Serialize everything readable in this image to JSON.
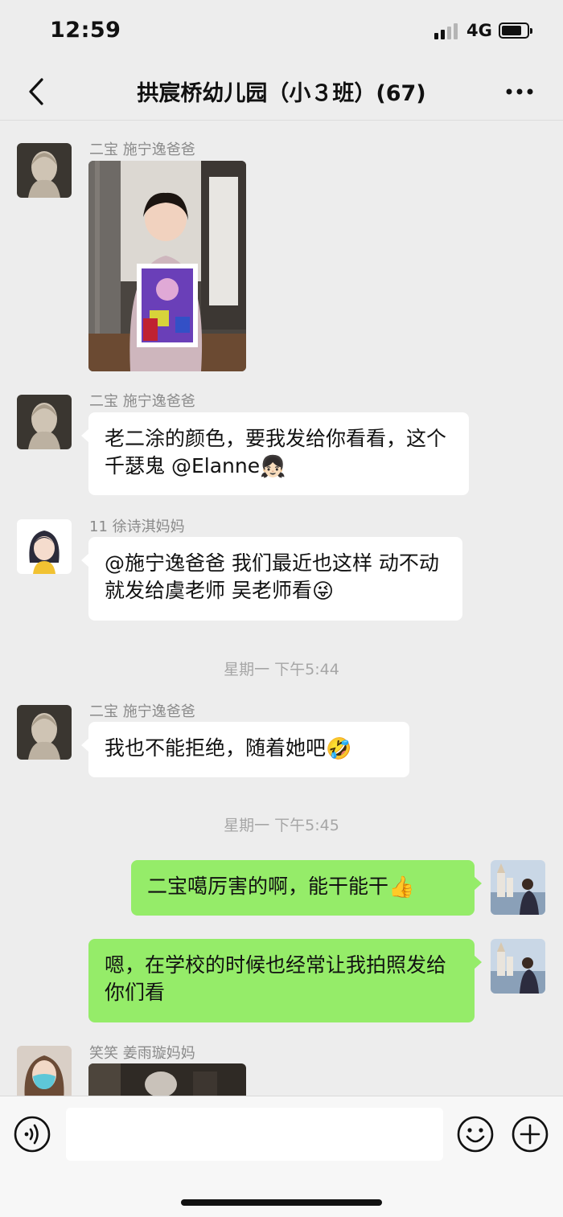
{
  "status_bar": {
    "time": "12:59",
    "network": "4G",
    "signal_bars": 4,
    "battery_level": 0.7
  },
  "header": {
    "title": "拱宸桥幼儿园（小３班）(67)"
  },
  "icons": {
    "back": "chevron-left-icon",
    "more": "more-dots-icon",
    "voice": "voice-icon",
    "emoji": "smiley-icon",
    "plus": "plus-icon",
    "girl_emoji": "👧🏻",
    "wink_emoji": "😜",
    "rofl_emoji": "🤣",
    "thumbs_emoji": "👍"
  },
  "messages": [
    {
      "sender": "二宝  施宁逸爸爸",
      "type": "image",
      "content": "photo-girl-with-drawing"
    },
    {
      "sender": "二宝  施宁逸爸爸",
      "text": "老二涂的颜色，要我发给你看看，这个千瑟鬼 @Elanne"
    },
    {
      "sender": "11  徐诗淇妈妈",
      "text": "@施宁逸爸爸 我们最近也这样 动不动就发给虞老师 吴老师看"
    },
    {
      "timestamp": "星期一 下午5:44"
    },
    {
      "sender": "二宝  施宁逸爸爸",
      "text": "我也不能拒绝，随着她吧"
    },
    {
      "timestamp": "星期一 下午5:45"
    },
    {
      "self": true,
      "text": "二宝噶厉害的啊，能干能干"
    },
    {
      "self": true,
      "text": "嗯，在学校的时候也经常让我拍照发给你们看"
    },
    {
      "sender": "笑笑  姜雨璇妈妈",
      "type": "image",
      "content": "photo-partial"
    }
  ],
  "input": {
    "value": "",
    "placeholder": ""
  },
  "colors": {
    "background": "#ededed",
    "self_bubble": "#95ec69",
    "other_bubble": "#ffffff",
    "meta_text": "#8a8a8a"
  }
}
